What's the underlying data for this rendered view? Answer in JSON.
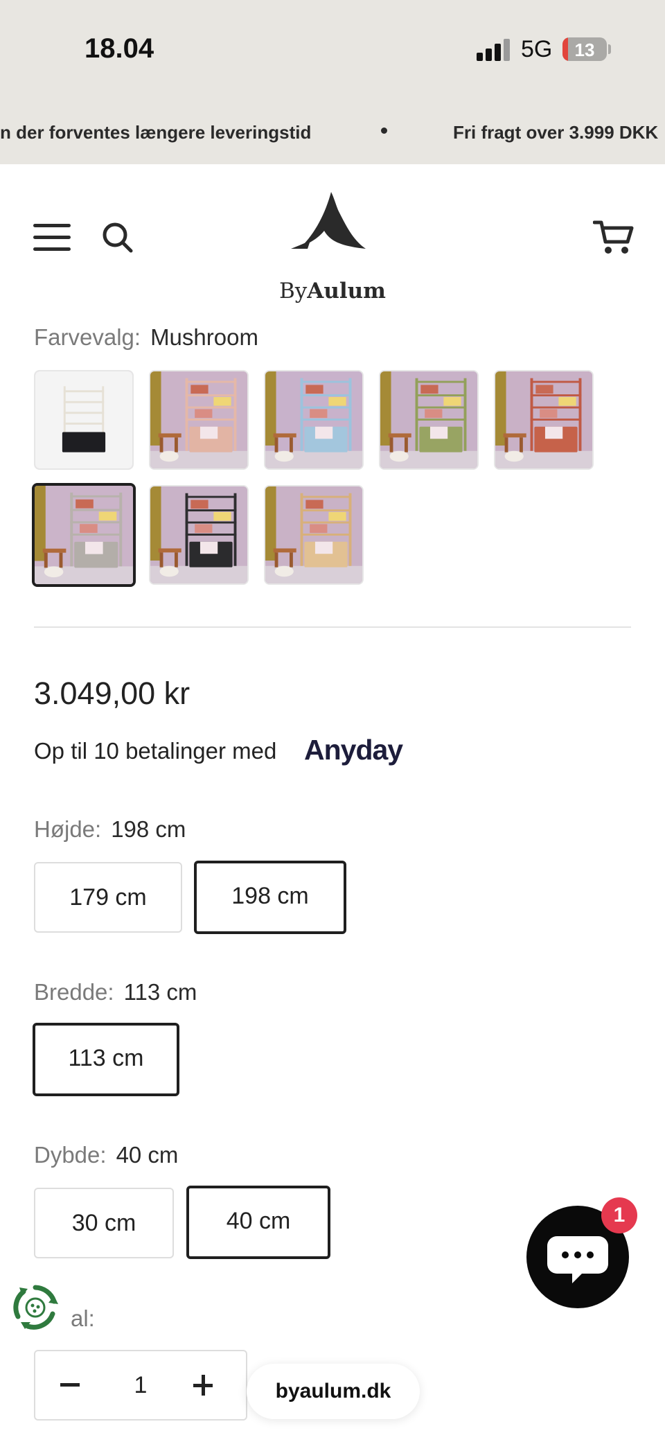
{
  "status_bar": {
    "time": "18.04",
    "network": "5G",
    "battery": "13",
    "signal_icon": "cellular-signal-icon",
    "battery_icon": "battery-icon"
  },
  "announcement": {
    "items": [
      "n der forventes længere leveringstid",
      "Fri fragt over 3.999 DKK"
    ]
  },
  "header": {
    "brand_prefix": "By",
    "brand_name": "Aulum",
    "menu_icon": "hamburger-menu-icon",
    "search_icon": "search-icon",
    "cart_icon": "shopping-cart-icon"
  },
  "product": {
    "color_label": "Farvevalg:",
    "color_value": "Mushroom",
    "swatches": [
      {
        "name": "black-white",
        "wall": "#f4f4f4",
        "frame": "#e6e1d6",
        "body": "#1e1e22"
      },
      {
        "name": "rose",
        "wall": "#cbb3c8",
        "frame": "#e5b8a8",
        "body": "#e2b4a4"
      },
      {
        "name": "sky-blue",
        "wall": "#c8b2cb",
        "frame": "#9cc3dd",
        "body": "#a3c6dd"
      },
      {
        "name": "olive",
        "wall": "#c8b2c8",
        "frame": "#93a05a",
        "body": "#98a463"
      },
      {
        "name": "terracotta",
        "wall": "#c9b1c6",
        "frame": "#c05a45",
        "body": "#c6624a"
      },
      {
        "name": "mushroom",
        "wall": "#cbb4c9",
        "frame": "#b8b2ac",
        "body": "#b3aea9"
      },
      {
        "name": "charcoal",
        "wall": "#c9b3c8",
        "frame": "#2e2e30",
        "body": "#2b2b2d"
      },
      {
        "name": "natural-wood",
        "wall": "#c9b2c6",
        "frame": "#d8b07a",
        "body": "#e2c193"
      }
    ],
    "price": "3.049,00 kr",
    "financing_text": "Op til 10 betalinger med",
    "financing_brand": "Anyday",
    "height": {
      "label": "Højde:",
      "value": "198 cm",
      "options": [
        "179 cm",
        "198 cm"
      ]
    },
    "width": {
      "label": "Bredde:",
      "value": "113 cm",
      "options": [
        "113 cm"
      ]
    },
    "depth": {
      "label": "Dybde:",
      "value": "40 cm",
      "options": [
        "30 cm",
        "40 cm"
      ]
    },
    "quantity": {
      "label": "al:",
      "value": "1"
    }
  },
  "chat": {
    "badge": "1",
    "icon": "chat-bubble-icon"
  },
  "eco_icon": "recycle-cookie-icon",
  "url_pill": "byaulum.dk",
  "colors": {
    "accent": "#1f1f1f",
    "badge": "#e5394f",
    "announce_bg": "#e8e6e1"
  }
}
